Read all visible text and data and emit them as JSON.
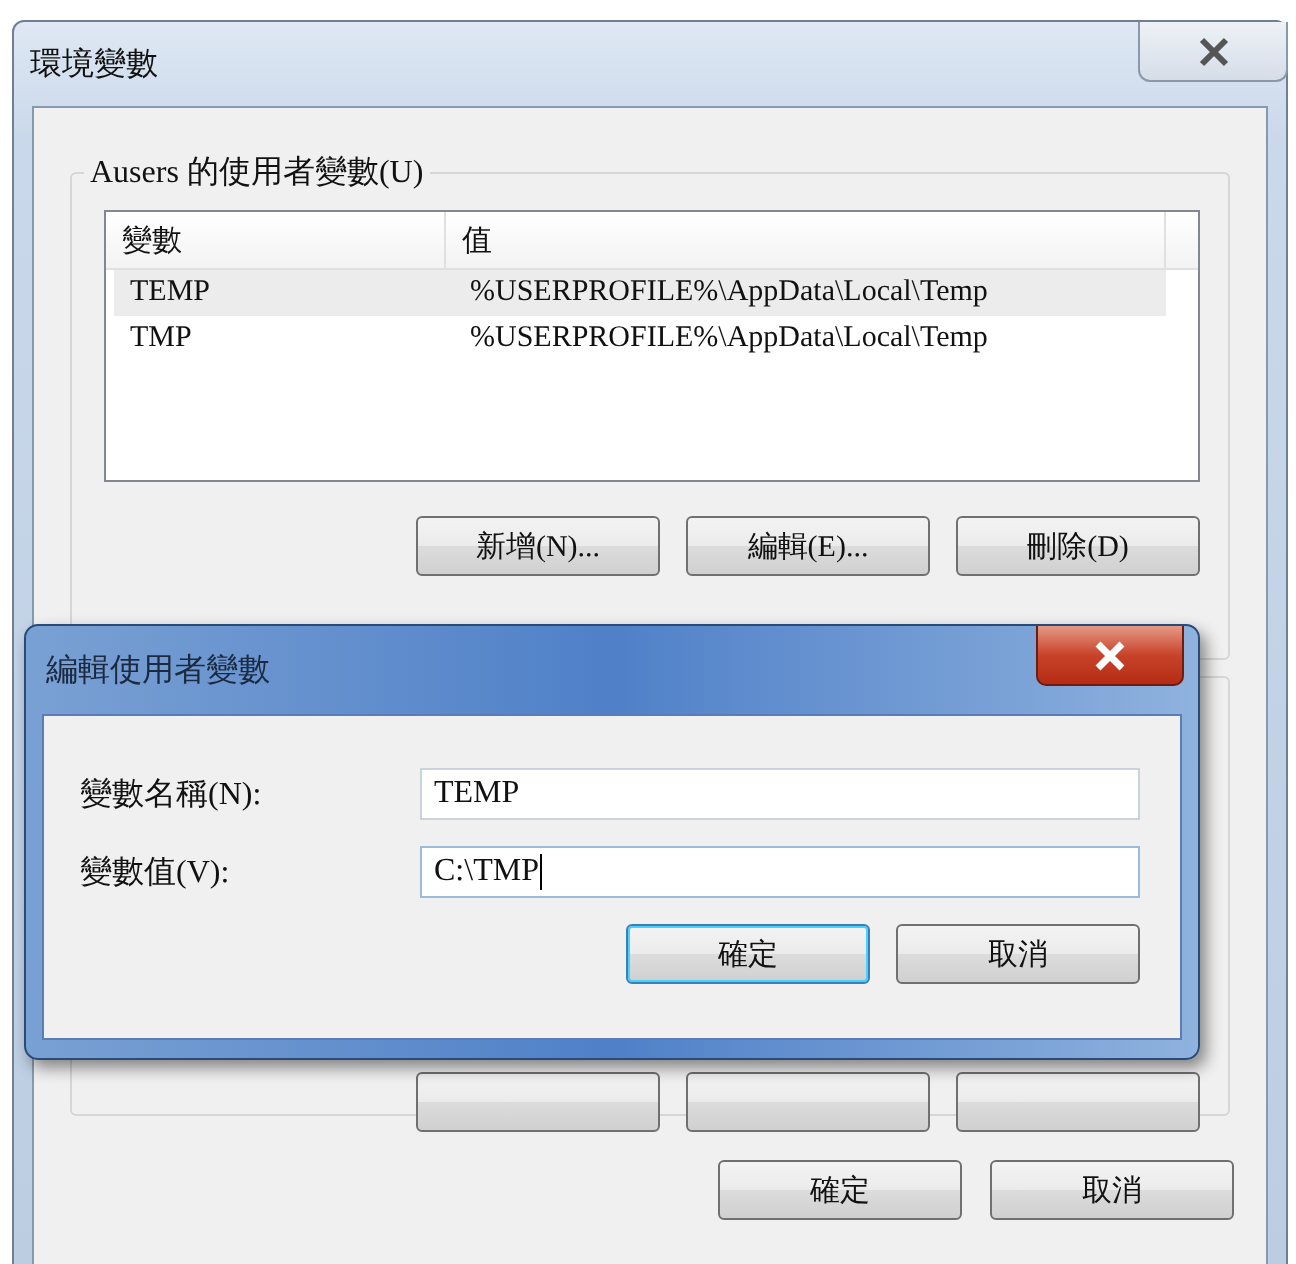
{
  "window": {
    "title": "環境變數",
    "buttons": [
      {
        "label": "確定",
        "default": false
      },
      {
        "label": "取消",
        "default": false
      }
    ]
  },
  "user_group": {
    "title": "Ausers 的使用者變數(U)",
    "columns": [
      "變數",
      "值"
    ],
    "rows": [
      {
        "name": "TEMP",
        "value": "%USERPROFILE%\\AppData\\Local\\Temp",
        "selected": true
      },
      {
        "name": "TMP",
        "value": "%USERPROFILE%\\AppData\\Local\\Temp",
        "selected": false
      }
    ],
    "buttons": [
      "新增(N)...",
      "編輯(E)...",
      "刪除(D)"
    ]
  },
  "dialog": {
    "title": "編輯使用者變數",
    "fields": [
      {
        "label": "變數名稱(N):",
        "value": "TEMP",
        "focused": false
      },
      {
        "label": "變數值(V):",
        "value": "C:\\TMP",
        "focused": true
      }
    ],
    "buttons": [
      {
        "label": "確定",
        "default": true
      },
      {
        "label": "取消",
        "default": false
      }
    ]
  }
}
